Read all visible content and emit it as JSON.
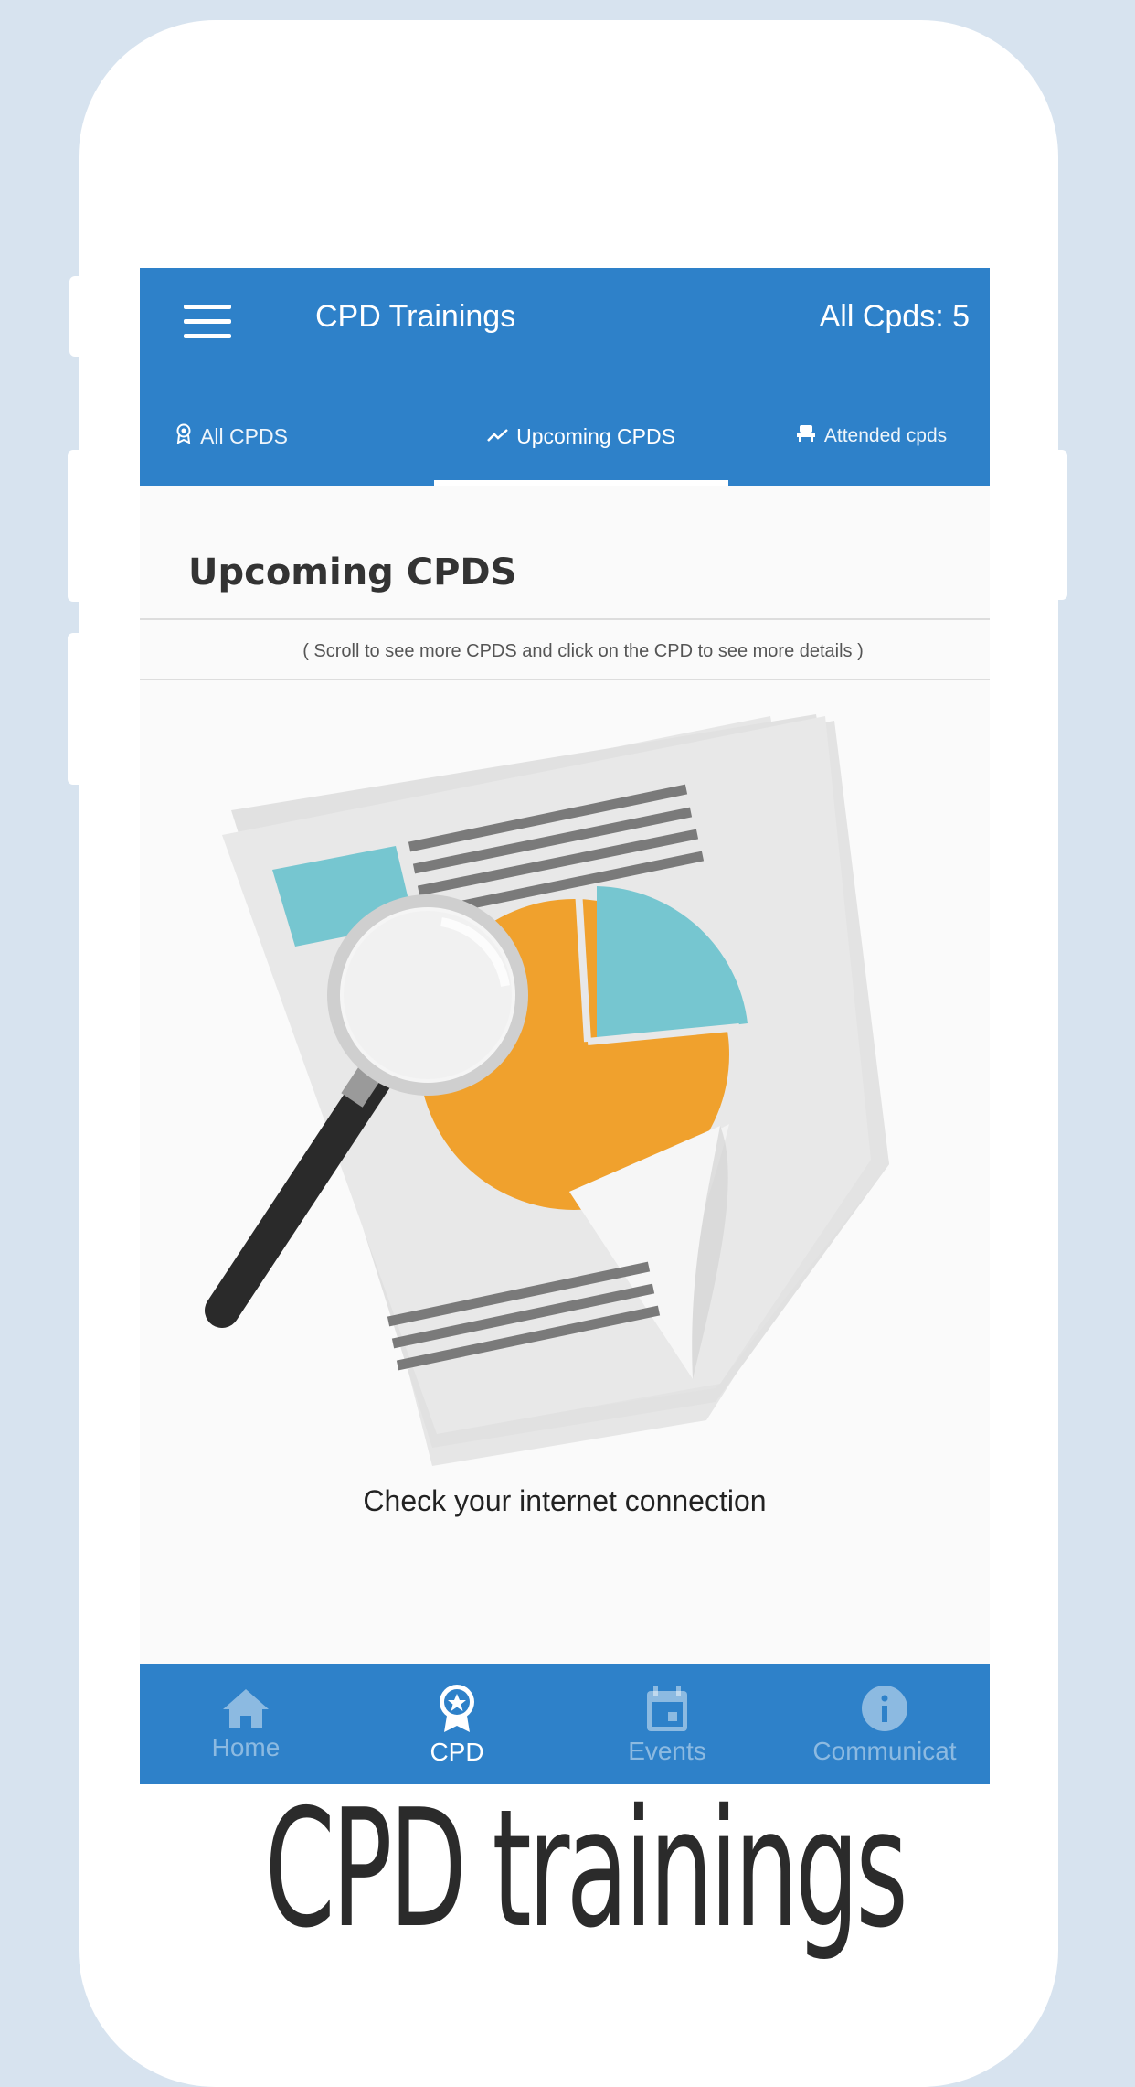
{
  "appbar": {
    "title": "CPD Trainings",
    "count_label": "All Cpds: 5"
  },
  "tabs": [
    {
      "label": "All CPDS",
      "icon": "award-icon"
    },
    {
      "label": "Upcoming CPDS",
      "icon": "trending-icon",
      "active": true
    },
    {
      "label": "Attended cpds",
      "icon": "seat-icon"
    }
  ],
  "section": {
    "title": "Upcoming CPDS",
    "hint": "( Scroll to see more CPDS and click on the CPD to see more details )"
  },
  "empty_state": {
    "illustration": "document-magnifier-illustration",
    "message": "Check your internet connection"
  },
  "bottom_nav": [
    {
      "label": "Home",
      "icon": "home-icon"
    },
    {
      "label": "CPD",
      "icon": "award-icon",
      "active": true
    },
    {
      "label": "Events",
      "icon": "calendar-icon"
    },
    {
      "label": "Communicat",
      "icon": "info-icon"
    }
  ],
  "caption": "CPD trainings",
  "colors": {
    "primary": "#2e81c9",
    "background": "#d7e3ef",
    "chart_orange": "#f0a12d",
    "chart_teal": "#76c6d0"
  }
}
